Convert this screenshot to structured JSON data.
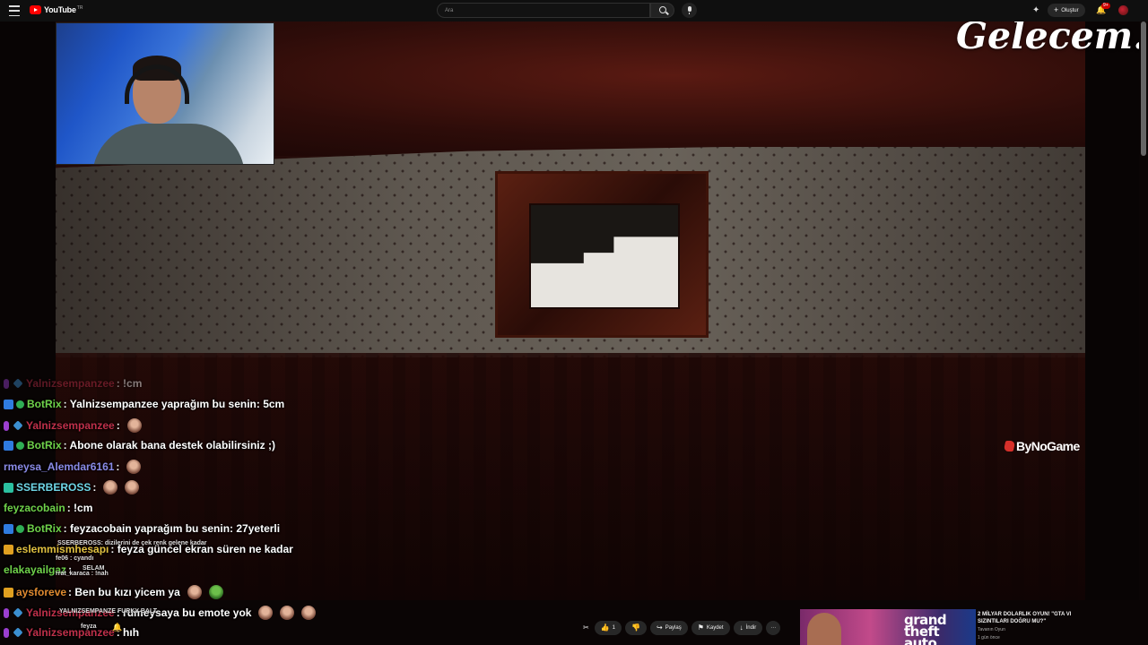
{
  "topbar": {
    "brand": "YouTube",
    "region": "TR",
    "search_placeholder": "Ara",
    "create_label": "Oluştur",
    "notification_count": "9+"
  },
  "overlay": {
    "title": "Gelecem...",
    "watermark": "ByNoGame"
  },
  "chat": [
    {
      "user": "Yalnizsempanzee",
      "message": ": !cm",
      "color": "#c0304a"
    },
    {
      "user": "BotRix",
      "message": ": Yalnizsempanzee yaprağım bu senin: 5cm",
      "color": "#6fd24a"
    },
    {
      "user": "Yalnizsempanzee",
      "message": ":",
      "color": "#c0304a"
    },
    {
      "user": "BotRix",
      "message": ": Abone olarak bana destek olabilirsiniz ;)",
      "color": "#6fd24a"
    },
    {
      "user": "rmeysa_Alemdar6161",
      "message": ":",
      "color": "#8a8ae6"
    },
    {
      "user": "SSERBEROSS",
      "message": ":",
      "color": "#6fd6e6"
    },
    {
      "user": "feyzacobain",
      "message": ": !cm",
      "color": "#6fd24a"
    },
    {
      "user": "BotRix",
      "message": ": feyzacobain yaprağım bu senin: 27yeterli",
      "color": "#6fd24a"
    },
    {
      "user": "eslemmismhesapı",
      "message": ": feyza güncel ekran süren ne kadar",
      "color": "#e0c040"
    },
    {
      "user": "elakayailgaz",
      "message": ":",
      "color": "#6fd24a"
    },
    {
      "user": "aysforeve",
      "message": ": Ben bu kızı yicem ya",
      "color": "#e08a30"
    },
    {
      "user": "Yalnizsempanzee",
      "message": ": rümeysaya bu emote yok",
      "color": "#c0304a"
    },
    {
      "user": "Yalnizsempanzee",
      "message": ": hıh",
      "color": "#c0304a"
    }
  ],
  "chat_overlaps": {
    "a": "SSERBEROSS: dizilerini de çek renk gelene kadar",
    "b": "fe06 : cyandı",
    "c": "SELAM",
    "d": "rrat_karaca : !nah",
    "e": "YALNIZSEMPANZE FURKY BALT"
  },
  "actions": {
    "likes": "1",
    "share": "Paylaş",
    "save": "Kaydet",
    "download": "İndir",
    "more": "···"
  },
  "bottom_left": {
    "user": "feyza"
  },
  "ad": {
    "title": "2 MİLYAR DOLARLIK OYUN! \"GTA VI SIZINTILARI DOĞRU MU?\"",
    "channel": "Tavanın Oyun",
    "meta": "1 gün önce",
    "logo": "grand theft auto"
  }
}
